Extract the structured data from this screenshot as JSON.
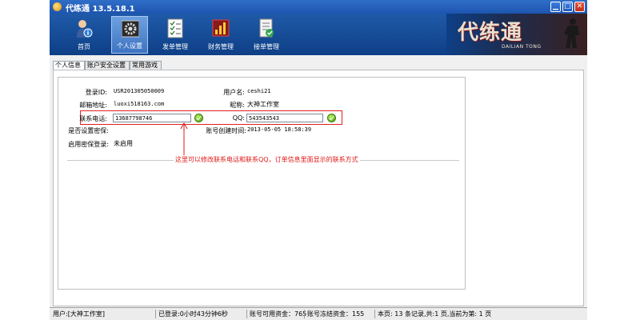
{
  "window": {
    "title": "代练通 13.5.18.1",
    "minimize": "▁",
    "maximize": "□",
    "close": "✕"
  },
  "toolbar": {
    "items": [
      {
        "label": "首页",
        "icon": "person-info-icon"
      },
      {
        "label": "个人设置",
        "icon": "settings-icon",
        "active": true
      },
      {
        "label": "发单管理",
        "icon": "checklist-icon"
      },
      {
        "label": "财务管理",
        "icon": "finance-chart-icon"
      },
      {
        "label": "接单管理",
        "icon": "order-accept-icon"
      }
    ],
    "logo_text": "代练通",
    "logo_sub": "DAILIAN TONG"
  },
  "tabs": [
    "个人信息",
    "账户安全设置",
    "常用游戏"
  ],
  "profile": {
    "login_id_label": "登录ID:",
    "login_id": "USR201305050009",
    "username_label": "用户名:",
    "username": "ceshi21",
    "email_label": "邮箱地址:",
    "email": "luoxi518163.com",
    "nickname_label": "昵称:",
    "nickname": "大神工作室",
    "phone_label": "联系电话:",
    "phone": "13687798746",
    "qq_label": "QQ:",
    "qq": "543543543",
    "pwd_protect_label": "是否设置密保:",
    "created_label": "账号创建时间:",
    "created": "2013-05-05 18:58:39",
    "pwd_enable_label": "启用密保登录:",
    "pwd_enable": "未启用"
  },
  "annotation": "这里可以修改联系电话和联系QQ，订单信息里面显示的联系方式",
  "status": {
    "user": "用户:[大神工作室]",
    "login_time": "已登录:0小时43分钟6秒",
    "available": "账号可用资金：765",
    "frozen": "账号冻结资金：155",
    "paging": "本页: 13 条记录,共:1 页,当前为第: 1 页"
  }
}
